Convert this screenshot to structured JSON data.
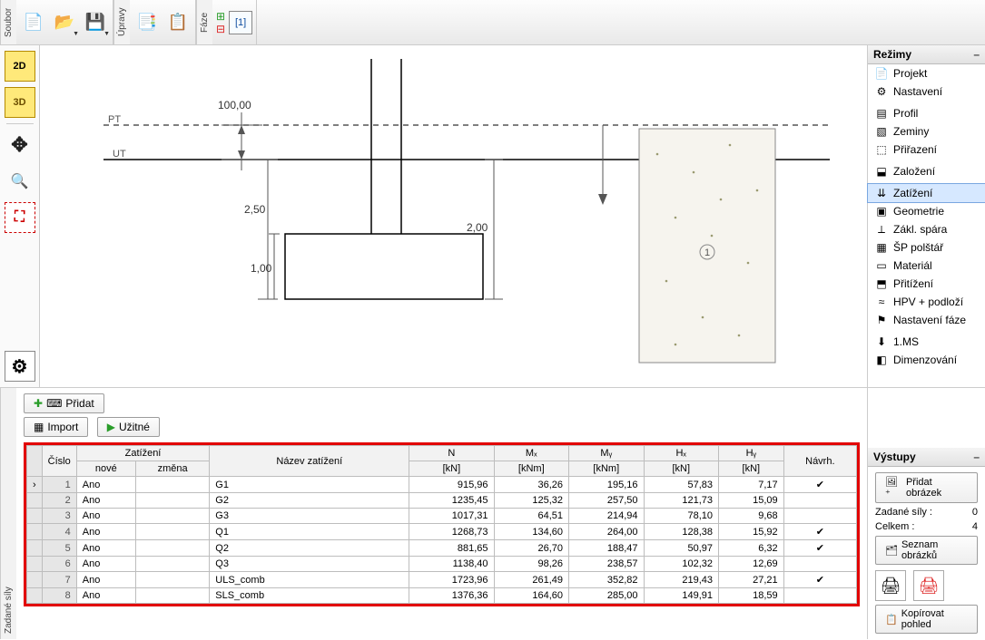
{
  "toolbar": {
    "file_label": "Soubor",
    "edit_label": "Úpravy",
    "phase_label": "Fáze",
    "phase_current": "[1]"
  },
  "modes": {
    "title": "Režimy",
    "items": [
      {
        "label": "Projekt"
      },
      {
        "label": "Nastavení"
      },
      {
        "label": "Profil"
      },
      {
        "label": "Zeminy"
      },
      {
        "label": "Přiřazení"
      },
      {
        "label": "Založení"
      },
      {
        "label": "Zatížení",
        "active": true
      },
      {
        "label": "Geometrie"
      },
      {
        "label": "Zákl. spára"
      },
      {
        "label": "ŠP polštář"
      },
      {
        "label": "Materiál"
      },
      {
        "label": "Přitížení"
      },
      {
        "label": "HPV + podloží"
      },
      {
        "label": "Nastavení fáze"
      },
      {
        "label": "1.MS"
      },
      {
        "label": "Dimenzování"
      }
    ]
  },
  "drawing": {
    "dim_top": "100,00",
    "dim_left": "2,50",
    "dim_h": "1,00",
    "dim_r": "2,00",
    "pt": "PT",
    "ut": "UT",
    "region": "1"
  },
  "bottom": {
    "panel_label": "Zadané síly",
    "add": "Přidat",
    "import": "Import",
    "service": "Užitné"
  },
  "table": {
    "headers": {
      "cislo": "Číslo",
      "zatizeni": "Zatížení",
      "nove": "nové",
      "zmena": "změna",
      "nazev": "Název zatížení",
      "N": "N",
      "Nx": "[kN]",
      "Mx": "Mₓ",
      "Mxu": "[kNm]",
      "My": "Mᵧ",
      "Myu": "[kNm]",
      "Hx": "Hₓ",
      "Hxu": "[kN]",
      "Hy": "Hᵧ",
      "Hyu": "[kN]",
      "navrh": "Návrh."
    },
    "rows": [
      {
        "n": "1",
        "nove": "Ano",
        "nazev": "G1",
        "N": "915,96",
        "Mx": "36,26",
        "My": "195,16",
        "Hx": "57,83",
        "Hy": "7,17",
        "navrh": "✔"
      },
      {
        "n": "2",
        "nove": "Ano",
        "nazev": "G2",
        "N": "1235,45",
        "Mx": "125,32",
        "My": "257,50",
        "Hx": "121,73",
        "Hy": "15,09",
        "navrh": ""
      },
      {
        "n": "3",
        "nove": "Ano",
        "nazev": "G3",
        "N": "1017,31",
        "Mx": "64,51",
        "My": "214,94",
        "Hx": "78,10",
        "Hy": "9,68",
        "navrh": ""
      },
      {
        "n": "4",
        "nove": "Ano",
        "nazev": "Q1",
        "N": "1268,73",
        "Mx": "134,60",
        "My": "264,00",
        "Hx": "128,38",
        "Hy": "15,92",
        "navrh": "✔"
      },
      {
        "n": "5",
        "nove": "Ano",
        "nazev": "Q2",
        "N": "881,65",
        "Mx": "26,70",
        "My": "188,47",
        "Hx": "50,97",
        "Hy": "6,32",
        "navrh": "✔"
      },
      {
        "n": "6",
        "nove": "Ano",
        "nazev": "Q3",
        "N": "1138,40",
        "Mx": "98,26",
        "My": "238,57",
        "Hx": "102,32",
        "Hy": "12,69",
        "navrh": ""
      },
      {
        "n": "7",
        "nove": "Ano",
        "nazev": "ULS_comb",
        "N": "1723,96",
        "Mx": "261,49",
        "My": "352,82",
        "Hx": "219,43",
        "Hy": "27,21",
        "navrh": "✔"
      },
      {
        "n": "8",
        "nove": "Ano",
        "nazev": "SLS_comb",
        "N": "1376,36",
        "Mx": "164,60",
        "My": "285,00",
        "Hx": "149,91",
        "Hy": "18,59",
        "navrh": ""
      }
    ]
  },
  "outputs": {
    "title": "Výstupy",
    "add_pic": "Přidat obrázek",
    "zs": "Zadané síly :",
    "zs_v": "0",
    "tot": "Celkem :",
    "tot_v": "4",
    "list": "Seznam obrázků",
    "copy": "Kopírovat pohled"
  }
}
